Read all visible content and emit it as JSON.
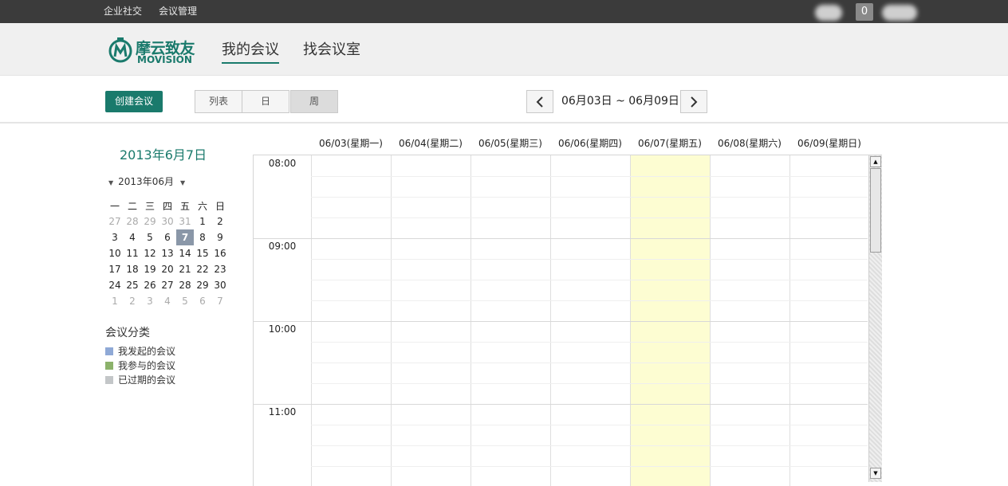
{
  "topbar": {
    "links": [
      "企业社交",
      "会议管理"
    ],
    "notification_count": "0"
  },
  "header": {
    "logo_cn": "摩云致友",
    "logo_en": "MOVISION",
    "nav": [
      "我的会议",
      "找会议室"
    ]
  },
  "toolbar": {
    "create_label": "创建会议",
    "views": [
      "列表",
      "日",
      "周"
    ],
    "selected_view": "周",
    "prev_icon": "‹",
    "next_icon": "›",
    "range": "06月03日 ~ 06月09日"
  },
  "sidebar": {
    "current_date": "2013年6月7日",
    "month_label": "2013年06月",
    "weekdays": [
      "一",
      "二",
      "三",
      "四",
      "五",
      "六",
      "日"
    ],
    "weeks": [
      [
        "27",
        "28",
        "29",
        "30",
        "31",
        "1",
        "2"
      ],
      [
        "3",
        "4",
        "5",
        "6",
        "7",
        "8",
        "9"
      ],
      [
        "10",
        "11",
        "12",
        "13",
        "14",
        "15",
        "16"
      ],
      [
        "17",
        "18",
        "19",
        "20",
        "21",
        "22",
        "23"
      ],
      [
        "24",
        "25",
        "26",
        "27",
        "28",
        "29",
        "30"
      ],
      [
        "1",
        "2",
        "3",
        "4",
        "5",
        "6",
        "7"
      ]
    ],
    "selected_day": "7",
    "category_title": "会议分类",
    "categories": [
      {
        "label": "我发起的会议",
        "color": "#8fa9d6"
      },
      {
        "label": "我参与的会议",
        "color": "#8cb26b"
      },
      {
        "label": "已过期的会议",
        "color": "#c3c6c8"
      }
    ]
  },
  "calendar": {
    "days": [
      "06/03(星期一)",
      "06/04(星期二)",
      "06/05(星期三)",
      "06/06(星期四)",
      "06/07(星期五)",
      "06/08(星期六)",
      "06/09(星期日)"
    ],
    "today_index": 4,
    "times": [
      "08:00",
      "09:00",
      "10:00",
      "11:00"
    ]
  },
  "colors": {
    "accent": "#1a7a6c",
    "today_bg": "#fdfdd2",
    "topbar": "#3b3b3b"
  }
}
